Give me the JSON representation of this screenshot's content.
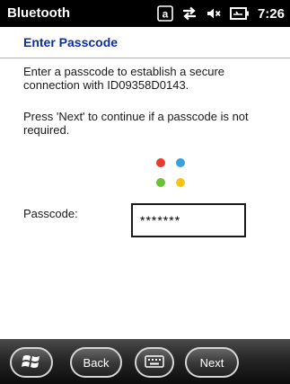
{
  "status_bar": {
    "app_title": "Bluetooth",
    "time": "7:26",
    "icons": [
      "keyboard-mode-a-icon",
      "connectivity-arrows-icon",
      "speaker-muted-icon",
      "battery-charging-icon"
    ]
  },
  "header": {
    "title": "Enter Passcode",
    "title_color": "#0b2fa3"
  },
  "main": {
    "instruction_1": "Enter a passcode to establish a secure connection with ID09358D0143.",
    "instruction_2": "Press 'Next' to continue if a passcode is not required.",
    "passcode_label": "Passcode:",
    "passcode_value": "*******"
  },
  "logo_colors": [
    "#e63b2e",
    "#3aa0dd",
    "#6bbf3a",
    "#f4c417"
  ],
  "bottom_bar": {
    "start_icon": "windows-start-icon",
    "back_label": "Back",
    "keyboard_icon": "keyboard-icon",
    "next_label": "Next"
  }
}
